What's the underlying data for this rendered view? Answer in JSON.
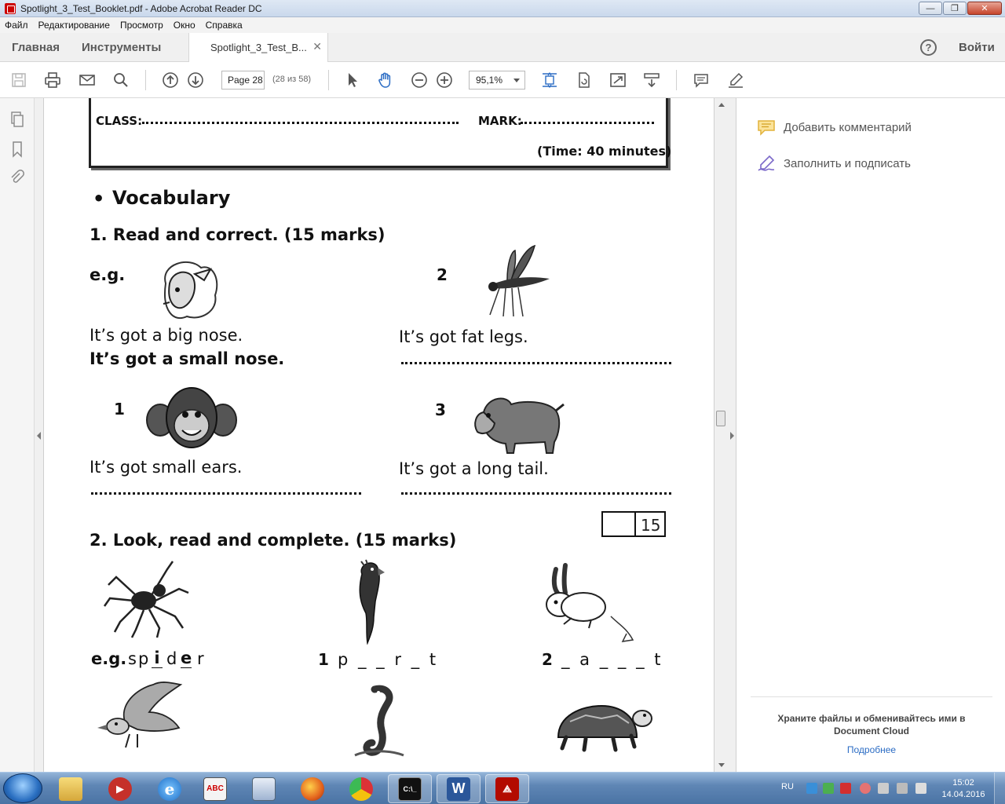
{
  "window": {
    "title": "Spotlight_3_Test_Booklet.pdf - Adobe Acrobat Reader DC"
  },
  "menu": [
    "Файл",
    "Редактирование",
    "Просмотр",
    "Окно",
    "Справка"
  ],
  "tabs": {
    "home": "Главная",
    "tools": "Инструменты",
    "document": "Spotlight_3_Test_B...",
    "signin": "Войти",
    "help": "?"
  },
  "toolbar": {
    "page_input": "Page 28",
    "page_count": "(28 из 58)",
    "zoom": "95,1%"
  },
  "right_pane": {
    "add_comment": "Добавить комментарий",
    "fill_sign": "Заполнить и подписать",
    "cloud_promo": "Храните файлы и обменивайтесь ими в Document Cloud",
    "more": "Подробнее"
  },
  "worksheet": {
    "class_label": "CLASS:",
    "mark_label": "MARK:",
    "time": "(Time: 40 minutes)",
    "bullet": "•",
    "section": "Vocabulary",
    "task1": "1. Read and correct. (15 marks)",
    "eg": "e.g.",
    "eg_wrong": "It’s got a big nose.",
    "eg_right": "It’s got a small nose.",
    "n1": "1",
    "s1": "It’s got small ears.",
    "n2": "2",
    "s2": "It’s got fat legs.",
    "n3": "3",
    "s3": "It’s got a long tail.",
    "score": "15",
    "task2": "2. Look, read and complete. (15 marks)",
    "w_eg_label": "e.g.",
    "w_eg_pre": "sp",
    "w_eg_i": "i",
    "w_eg_d": "d",
    "w_eg_e": "e",
    "w_eg_r": "r",
    "w1_num": "1",
    "w1": "p _ _ r _ t",
    "w2_num": "2",
    "w2": "_ a _ _ _ t"
  },
  "taskbar": {
    "lang": "RU",
    "time": "15:02",
    "date": "14.04.2016"
  },
  "colors": {
    "accent_blue": "#2b6cc4",
    "acrobat_red": "#c00000",
    "comment_yellow": "#f1c232",
    "fill_sign_purple": "#7b68c9"
  }
}
